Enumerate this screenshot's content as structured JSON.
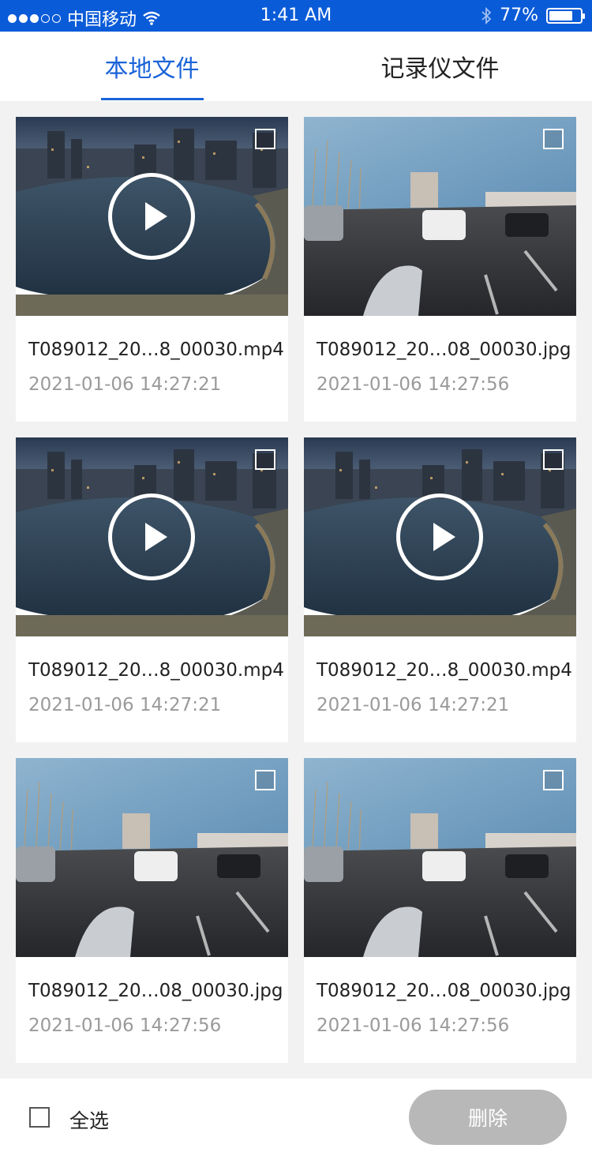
{
  "status_bar": {
    "carrier": "中国移动",
    "time": "1:41 AM",
    "battery": "77%",
    "battery_level": 0.77,
    "icons": [
      "signal-dots",
      "wifi-icon",
      "bluetooth-icon",
      "battery-icon"
    ]
  },
  "tabs": [
    {
      "label": "本地文件",
      "active": true
    },
    {
      "label": "记录仪文件",
      "active": false
    }
  ],
  "files": [
    {
      "name": "T089012_20…8_00030.mp4",
      "date": "2021-01-06 14:27:21",
      "type": "video"
    },
    {
      "name": "T089012_20…08_00030.jpg",
      "date": "2021-01-06 14:27:56",
      "type": "image"
    },
    {
      "name": "T089012_20…8_00030.mp4",
      "date": "2021-01-06 14:27:21",
      "type": "video"
    },
    {
      "name": "T089012_20…8_00030.mp4",
      "date": "2021-01-06 14:27:21",
      "type": "video"
    },
    {
      "name": "T089012_20…08_00030.jpg",
      "date": "2021-01-06 14:27:56",
      "type": "image"
    },
    {
      "name": "T089012_20…08_00030.jpg",
      "date": "2021-01-06 14:27:56",
      "type": "image"
    }
  ],
  "bottom_bar": {
    "select_all_label": "全选",
    "delete_label": "删除"
  },
  "colors": {
    "accent": "#1a63d8",
    "status_bar": "#0a5bd8",
    "delete_disabled": "#b8b8b8"
  }
}
